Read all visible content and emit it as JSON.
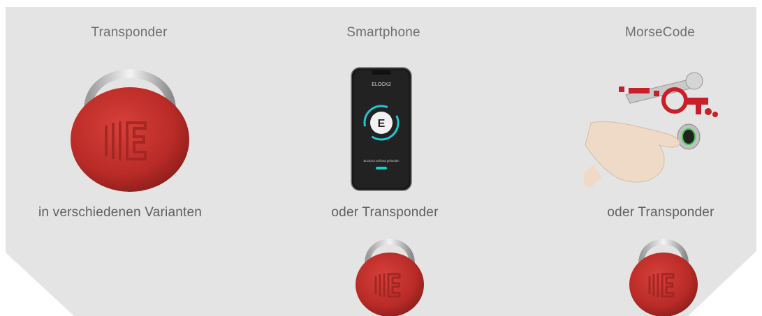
{
  "columns": [
    {
      "title": "Transponder",
      "caption": "in verschiedenen Varianten",
      "image_icon": "red-transponder-keyfob-icon"
    },
    {
      "title": "Smartphone",
      "caption": "oder Transponder",
      "image_icon": "smartphone-app-icon",
      "phone": {
        "brand": "ELOCK2",
        "status": "ELOCK2 Schloss gefunden"
      },
      "extra_icon": "red-transponder-keyfob-icon"
    },
    {
      "title": "MorseCode",
      "caption": "oder Transponder",
      "image_icon": "morse-code-hand-icon",
      "extra_icon": "red-transponder-keyfob-icon"
    }
  ],
  "colors": {
    "panel": "#e4e4e4",
    "text": "#6f6f6f",
    "transponder_red": "#c0312c",
    "app_accent": "#20c7cf"
  }
}
